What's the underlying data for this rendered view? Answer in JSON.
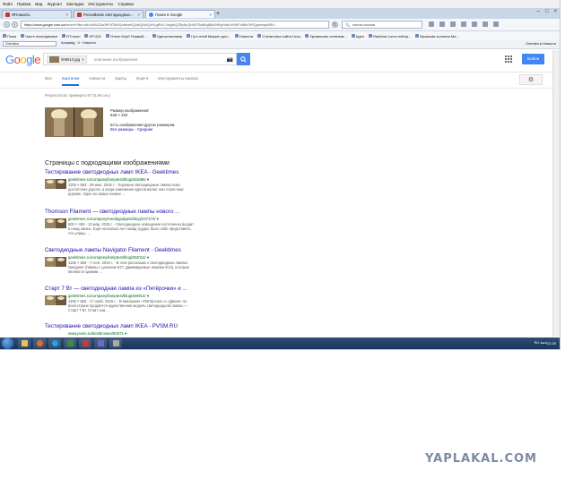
{
  "menu": [
    "Файл",
    "Правка",
    "Вид",
    "Журнал",
    "Закладки",
    "Инструменты",
    "Справка"
  ],
  "tabs": [
    {
      "label": "ЯПлакалъ",
      "active": false
    },
    {
      "label": "Российские светодиодные...",
      "active": false
    },
    {
      "label": "Поиск в Google",
      "active": true
    }
  ],
  "url": {
    "host": "https://www.google.com.ua",
    "rest": "/search?tbs=sbi:AMhZZiu0HFdTMzZpdsbeKQJdtQ6WQzHLgfRv1-NcgfvQZ5lyKpQhH0TAsBhgBkA9tRyIhIbbJx0IKFIxlBbTxRQpbmqaEiBV..."
  },
  "browser_search": {
    "placeholder": "сняли ссылки"
  },
  "bookmarks": [
    "Пожа",
    "Часто посещаемые",
    "RTmoon",
    "DP-621",
    "Отель Клуб Первый ...",
    "Одноклассники",
    "Гугл плей Маркет дли...",
    "Новости",
    "Статистика сайта Ucoz",
    "Украинские селеним...",
    "Ageo ",
    "Rainbow Loom набор...",
    "Бразская колонна Ма..."
  ],
  "addon": {
    "select": "Gremlins",
    "mid": "Апокмед  ·  4  ·  Новости",
    "right": "Gremlins ▸ Новости"
  },
  "google": {
    "logo": [
      {
        "ch": "G",
        "color": "#4285f4"
      },
      {
        "ch": "o",
        "color": "#ea4335"
      },
      {
        "ch": "o",
        "color": "#fbbc05"
      },
      {
        "ch": "g",
        "color": "#4285f4"
      },
      {
        "ch": "l",
        "color": "#34a853"
      },
      {
        "ch": "e",
        "color": "#ea4335"
      }
    ],
    "chip": "006510.jpg",
    "placeholder": "описание изображения",
    "signin": "Войти",
    "tabs": [
      "Все",
      "Картинки",
      "Новости",
      "Карты",
      "Ещё ▾",
      "Инструменты поиска"
    ],
    "active_tab": 1
  },
  "stats": "Результатов: примерно 87 (0,66 сек.)",
  "image_info": {
    "size_label": "Размер изображения:",
    "size": "648 × 320",
    "other_sizes": "Есть изображения других размеров.",
    "links": "Все размеры - Средние"
  },
  "section_title": "Страницы с подходящими изображениями",
  "results": [
    {
      "title": "Тестирование светодиодных ламп IKEA - Geektimes",
      "url": "geektimes.ru/company/lamptest/blog/252686/ ▾",
      "desc": [
        "1108 × 553 - 29 июн. 2015 г. - Хорошие светодиодные лампы пока",
        "достаточно дороги, а когда изменение курсов валют они стали ещё",
        "дороже. Одно из самых низких ..."
      ]
    },
    {
      "title": "Thomson Filament — светодиодные лампы нового ...",
      "url": "geektimes.ru/company/mediagadgets/blog/247172/ ▾",
      "desc": [
        "600 × 450 - 13 мар. 2015 г. - Светодиодное освещение постепенно входит",
        "в нашу жизнь. Ещё несколько лет назад трудно было себе представить,",
        "что улицы ..."
      ]
    },
    {
      "title": "Светодиодные лампы Navigator Filament - Geektimes",
      "url": "geektimes.ru/company/lamptest/blog/262014/ ▾",
      "desc": [
        "1108 × 553 - 7 сент. 2015 г. - В этих рассказаю о светодиодных лампах",
        "Navigator (Лампы с цоколем E27, Диммируемые изнизки E14), которые",
        "являются одними ..."
      ]
    },
    {
      "title": "Старт 7 Вт — светодиодная лампа из «Пятёрочки» и ...",
      "url": "geektimes.ru/company/lamptest/blog/260914/ ▾",
      "desc": [
        "1108 × 553 - 17 нояб. 2015 г. - В магазинах «Пятёрочка» и «Дикси» по",
        "всей стране продаётся единственная модель светодиодной лампы —",
        "Старт 7 Вт. Стоит она ..."
      ]
    },
    {
      "title": "Тестирование светодиодных ламп IKEA - PVSM.RU",
      "url": "www.pvsm.ru/bestbrowes/92971 ▾",
      "desc": []
    }
  ],
  "taskbar": {
    "tray": "RU  ◂  ▴  ▸",
    "clock": "22:39"
  },
  "watermark": "YAPLAKAL.COM"
}
